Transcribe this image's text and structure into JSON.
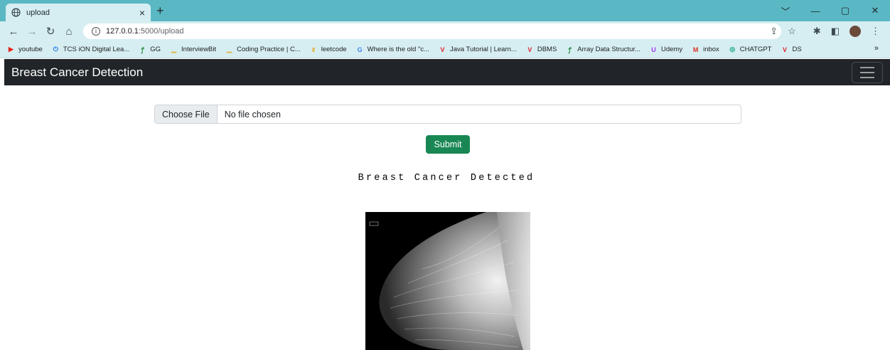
{
  "browser": {
    "tab_title": "upload",
    "tab_close": "×",
    "new_tab": "+",
    "url_host": "127.0.0.1",
    "url_rest": ":5000/upload",
    "window_controls": [
      "﹀",
      "—",
      "▢",
      "✕"
    ],
    "bookmarks": [
      {
        "label": "youtube",
        "icon": "youtube-icon",
        "color": "#e62117",
        "glyph": "▶"
      },
      {
        "label": "TCS iON Digital Lea...",
        "icon": "power-icon",
        "color": "#1a73e8",
        "glyph": "⏻"
      },
      {
        "label": "GG",
        "icon": "gfg-icon",
        "color": "#2f8d46",
        "glyph": "ꝭ"
      },
      {
        "label": "InterviewBit",
        "icon": "interviewbit-icon",
        "color": "#e0b341",
        "glyph": "▁"
      },
      {
        "label": "Coding Practice | C...",
        "icon": "coding-icon",
        "color": "#e0b341",
        "glyph": "▁"
      },
      {
        "label": "leetcode",
        "icon": "leetcode-icon",
        "color": "#e7a41d",
        "glyph": "ℓ"
      },
      {
        "label": "Where is the old \"c...",
        "icon": "google-icon",
        "color": "#4285f4",
        "glyph": "G"
      },
      {
        "label": "Java Tutorial | Learn...",
        "icon": "v-icon",
        "color": "#e21f2e",
        "glyph": "V"
      },
      {
        "label": "DBMS",
        "icon": "v-icon",
        "color": "#e21f2e",
        "glyph": "V"
      },
      {
        "label": "Array Data Structur...",
        "icon": "gfg-icon",
        "color": "#2f8d46",
        "glyph": "ꝭ"
      },
      {
        "label": "Udemy",
        "icon": "udemy-icon",
        "color": "#a435f0",
        "glyph": "U"
      },
      {
        "label": "inbox",
        "icon": "gmail-icon",
        "color": "#d93025",
        "glyph": "M"
      },
      {
        "label": "CHATGPT",
        "icon": "chatgpt-icon",
        "color": "#10a37f",
        "glyph": "◎"
      },
      {
        "label": "DS",
        "icon": "v-icon",
        "color": "#e21f2e",
        "glyph": "V"
      }
    ],
    "bookmarks_more": "»"
  },
  "page": {
    "brand": "Breast Cancer Detection",
    "file_button": "Choose File",
    "file_status": "No file chosen",
    "submit_label": "Submit",
    "result_text": "Breast Cancer Detected",
    "accent_color": "#198754",
    "navbar_color": "#212529"
  }
}
